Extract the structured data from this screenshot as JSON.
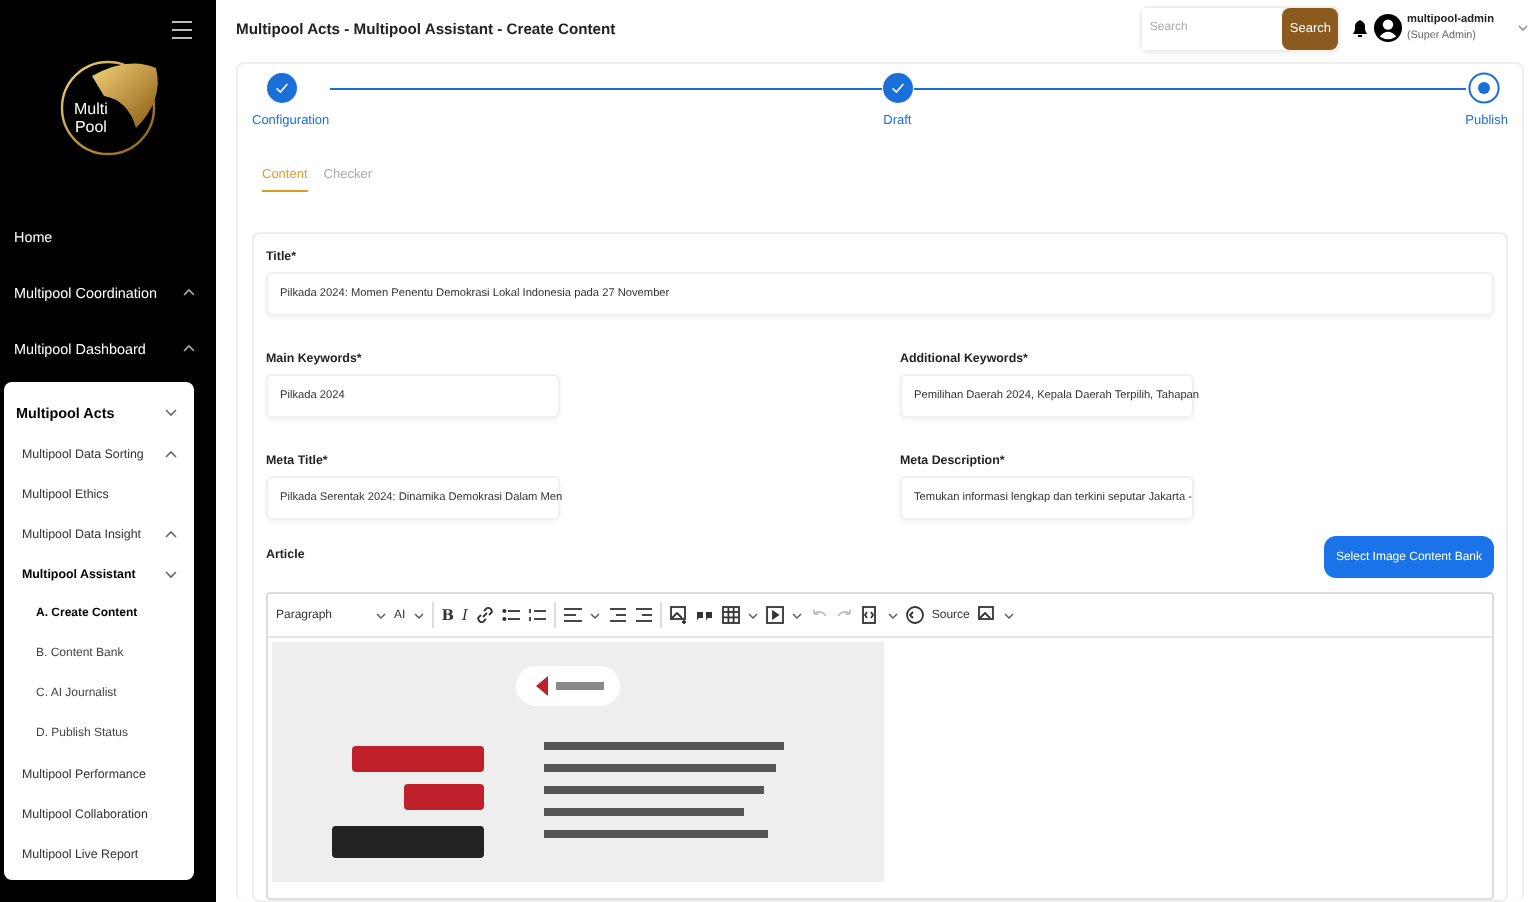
{
  "sidebar": {
    "logo": [
      "Multi",
      "Pool"
    ],
    "items": [
      {
        "label": "Home"
      },
      {
        "label": "Multipool Coordination",
        "expanded": false
      },
      {
        "label": "Multipool Dashboard",
        "expanded": false
      },
      {
        "label": "Multipool Acts",
        "expanded": true,
        "children": [
          {
            "label": "Multipool Data Sorting",
            "expanded": false
          },
          {
            "label": "Multipool Ethics"
          },
          {
            "label": "Multipool Data Insight",
            "expanded": false
          },
          {
            "label": "Multipool Assistant",
            "expanded": true,
            "children": [
              {
                "label": "A. Create Content",
                "selected": true
              },
              {
                "label": "B. Content Bank",
                "selected": false
              },
              {
                "label": "C. AI Journalist",
                "selected": false
              },
              {
                "label": "D. Publish Status",
                "selected": false
              }
            ]
          },
          {
            "label": "Multipool Performance"
          },
          {
            "label": "Multipool Collaboration"
          },
          {
            "label": "Multipool Live Report"
          }
        ]
      }
    ]
  },
  "header": {
    "breadcrumb": "Multipool Acts - Multipool Assistant - Create Content",
    "search": {
      "placeholder": "Search",
      "button": "Search"
    },
    "user": {
      "name": "multipool-admin",
      "role": "(Super Admin)"
    }
  },
  "stepper": {
    "steps": [
      {
        "label": "Configuration",
        "done": true
      },
      {
        "label": "Draft",
        "done": true
      },
      {
        "label": "Publish",
        "done": false
      }
    ]
  },
  "tabs": [
    {
      "label": "Content",
      "selected": true
    },
    {
      "label": "Checker",
      "selected": false
    }
  ],
  "form": {
    "title": {
      "label": "Title*",
      "value": "Pilkada 2024: Momen Penentu Demokrasi Lokal Indonesia pada 27 November"
    },
    "fields": [
      {
        "label": "Main Keywords*",
        "value": "Pilkada 2024"
      },
      {
        "label": "Additional Keywords*",
        "value": "Pemilihan Daerah 2024, Kepala Daerah Terpilih, Tahapan"
      },
      {
        "label": "Meta Title*",
        "value": "Pilkada Serentak 2024: Dinamika Demokrasi Dalam Men"
      },
      {
        "label": "Meta Description*",
        "value": "Temukan informasi lengkap dan terkini seputar Jakarta -"
      }
    ],
    "article": {
      "label": "Article",
      "button": "Select Image Content Bank",
      "toolbar": {
        "format": "Paragraph",
        "size": "AI",
        "bold": "B",
        "italic": "I",
        "source": "Source",
        "undo_disabled": true
      }
    }
  }
}
